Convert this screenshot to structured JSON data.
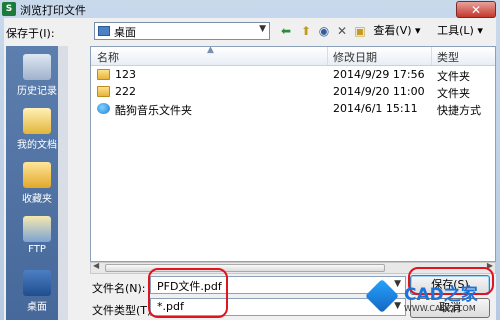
{
  "window": {
    "title": "浏览打印文件",
    "icon_text": "S",
    "close_symbol": "✕"
  },
  "toolbar": {
    "save_in_label": "保存于(I):",
    "location": "桌面",
    "view_label": "查看(V)",
    "tools_label": "工具(L)"
  },
  "sidebar": {
    "items": [
      {
        "label": "历史记录"
      },
      {
        "label": "我的文档"
      },
      {
        "label": "收藏夹"
      },
      {
        "label": "FTP"
      },
      {
        "label": "桌面"
      }
    ]
  },
  "file_list": {
    "columns": [
      "名称",
      "修改日期",
      "类型"
    ],
    "rows": [
      {
        "name": "123",
        "date": "2014/9/29 17:56",
        "type": "文件夹",
        "icon": "folder-icon"
      },
      {
        "name": "222",
        "date": "2014/9/20 11:00",
        "type": "文件夹",
        "icon": "folder-icon"
      },
      {
        "name": "酷狗音乐文件夹",
        "date": "2014/6/1 15:11",
        "type": "快捷方式",
        "icon": "shortcut-icon"
      }
    ]
  },
  "form": {
    "filename_label": "文件名(N):",
    "filename_value": "PFD文件.pdf",
    "filetype_label": "文件类型(T):",
    "filetype_value": "*.pdf",
    "save_button": "保存(S)",
    "cancel_button": "取消"
  },
  "watermark": {
    "text": "CAD之家",
    "url": "WWW.CADZJ.COM"
  },
  "colors": {
    "highlight": "#e0141e",
    "sidebar": "#5d7fae"
  }
}
